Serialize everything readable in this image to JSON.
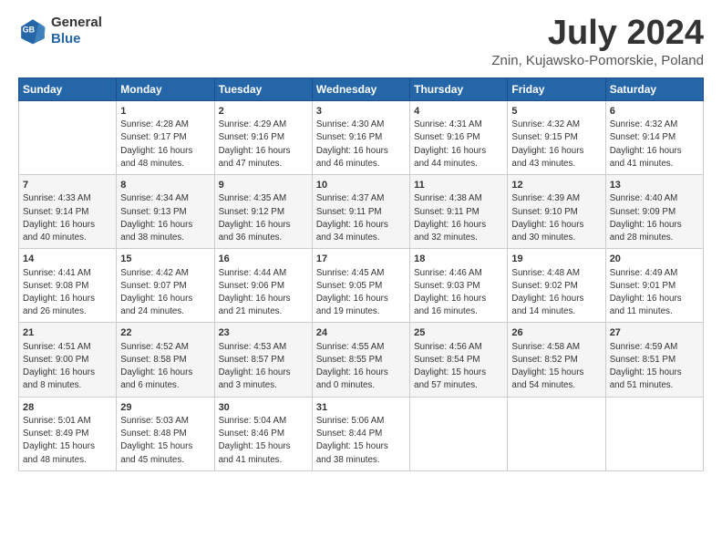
{
  "logo": {
    "line1": "General",
    "line2": "Blue"
  },
  "title": "July 2024",
  "subtitle": "Znin, Kujawsko-Pomorskie, Poland",
  "days_header": [
    "Sunday",
    "Monday",
    "Tuesday",
    "Wednesday",
    "Thursday",
    "Friday",
    "Saturday"
  ],
  "weeks": [
    [
      {
        "day": "",
        "text": ""
      },
      {
        "day": "1",
        "text": "Sunrise: 4:28 AM\nSunset: 9:17 PM\nDaylight: 16 hours\nand 48 minutes."
      },
      {
        "day": "2",
        "text": "Sunrise: 4:29 AM\nSunset: 9:16 PM\nDaylight: 16 hours\nand 47 minutes."
      },
      {
        "day": "3",
        "text": "Sunrise: 4:30 AM\nSunset: 9:16 PM\nDaylight: 16 hours\nand 46 minutes."
      },
      {
        "day": "4",
        "text": "Sunrise: 4:31 AM\nSunset: 9:16 PM\nDaylight: 16 hours\nand 44 minutes."
      },
      {
        "day": "5",
        "text": "Sunrise: 4:32 AM\nSunset: 9:15 PM\nDaylight: 16 hours\nand 43 minutes."
      },
      {
        "day": "6",
        "text": "Sunrise: 4:32 AM\nSunset: 9:14 PM\nDaylight: 16 hours\nand 41 minutes."
      }
    ],
    [
      {
        "day": "7",
        "text": "Sunrise: 4:33 AM\nSunset: 9:14 PM\nDaylight: 16 hours\nand 40 minutes."
      },
      {
        "day": "8",
        "text": "Sunrise: 4:34 AM\nSunset: 9:13 PM\nDaylight: 16 hours\nand 38 minutes."
      },
      {
        "day": "9",
        "text": "Sunrise: 4:35 AM\nSunset: 9:12 PM\nDaylight: 16 hours\nand 36 minutes."
      },
      {
        "day": "10",
        "text": "Sunrise: 4:37 AM\nSunset: 9:11 PM\nDaylight: 16 hours\nand 34 minutes."
      },
      {
        "day": "11",
        "text": "Sunrise: 4:38 AM\nSunset: 9:11 PM\nDaylight: 16 hours\nand 32 minutes."
      },
      {
        "day": "12",
        "text": "Sunrise: 4:39 AM\nSunset: 9:10 PM\nDaylight: 16 hours\nand 30 minutes."
      },
      {
        "day": "13",
        "text": "Sunrise: 4:40 AM\nSunset: 9:09 PM\nDaylight: 16 hours\nand 28 minutes."
      }
    ],
    [
      {
        "day": "14",
        "text": "Sunrise: 4:41 AM\nSunset: 9:08 PM\nDaylight: 16 hours\nand 26 minutes."
      },
      {
        "day": "15",
        "text": "Sunrise: 4:42 AM\nSunset: 9:07 PM\nDaylight: 16 hours\nand 24 minutes."
      },
      {
        "day": "16",
        "text": "Sunrise: 4:44 AM\nSunset: 9:06 PM\nDaylight: 16 hours\nand 21 minutes."
      },
      {
        "day": "17",
        "text": "Sunrise: 4:45 AM\nSunset: 9:05 PM\nDaylight: 16 hours\nand 19 minutes."
      },
      {
        "day": "18",
        "text": "Sunrise: 4:46 AM\nSunset: 9:03 PM\nDaylight: 16 hours\nand 16 minutes."
      },
      {
        "day": "19",
        "text": "Sunrise: 4:48 AM\nSunset: 9:02 PM\nDaylight: 16 hours\nand 14 minutes."
      },
      {
        "day": "20",
        "text": "Sunrise: 4:49 AM\nSunset: 9:01 PM\nDaylight: 16 hours\nand 11 minutes."
      }
    ],
    [
      {
        "day": "21",
        "text": "Sunrise: 4:51 AM\nSunset: 9:00 PM\nDaylight: 16 hours\nand 8 minutes."
      },
      {
        "day": "22",
        "text": "Sunrise: 4:52 AM\nSunset: 8:58 PM\nDaylight: 16 hours\nand 6 minutes."
      },
      {
        "day": "23",
        "text": "Sunrise: 4:53 AM\nSunset: 8:57 PM\nDaylight: 16 hours\nand 3 minutes."
      },
      {
        "day": "24",
        "text": "Sunrise: 4:55 AM\nSunset: 8:55 PM\nDaylight: 16 hours\nand 0 minutes."
      },
      {
        "day": "25",
        "text": "Sunrise: 4:56 AM\nSunset: 8:54 PM\nDaylight: 15 hours\nand 57 minutes."
      },
      {
        "day": "26",
        "text": "Sunrise: 4:58 AM\nSunset: 8:52 PM\nDaylight: 15 hours\nand 54 minutes."
      },
      {
        "day": "27",
        "text": "Sunrise: 4:59 AM\nSunset: 8:51 PM\nDaylight: 15 hours\nand 51 minutes."
      }
    ],
    [
      {
        "day": "28",
        "text": "Sunrise: 5:01 AM\nSunset: 8:49 PM\nDaylight: 15 hours\nand 48 minutes."
      },
      {
        "day": "29",
        "text": "Sunrise: 5:03 AM\nSunset: 8:48 PM\nDaylight: 15 hours\nand 45 minutes."
      },
      {
        "day": "30",
        "text": "Sunrise: 5:04 AM\nSunset: 8:46 PM\nDaylight: 15 hours\nand 41 minutes."
      },
      {
        "day": "31",
        "text": "Sunrise: 5:06 AM\nSunset: 8:44 PM\nDaylight: 15 hours\nand 38 minutes."
      },
      {
        "day": "",
        "text": ""
      },
      {
        "day": "",
        "text": ""
      },
      {
        "day": "",
        "text": ""
      }
    ]
  ]
}
